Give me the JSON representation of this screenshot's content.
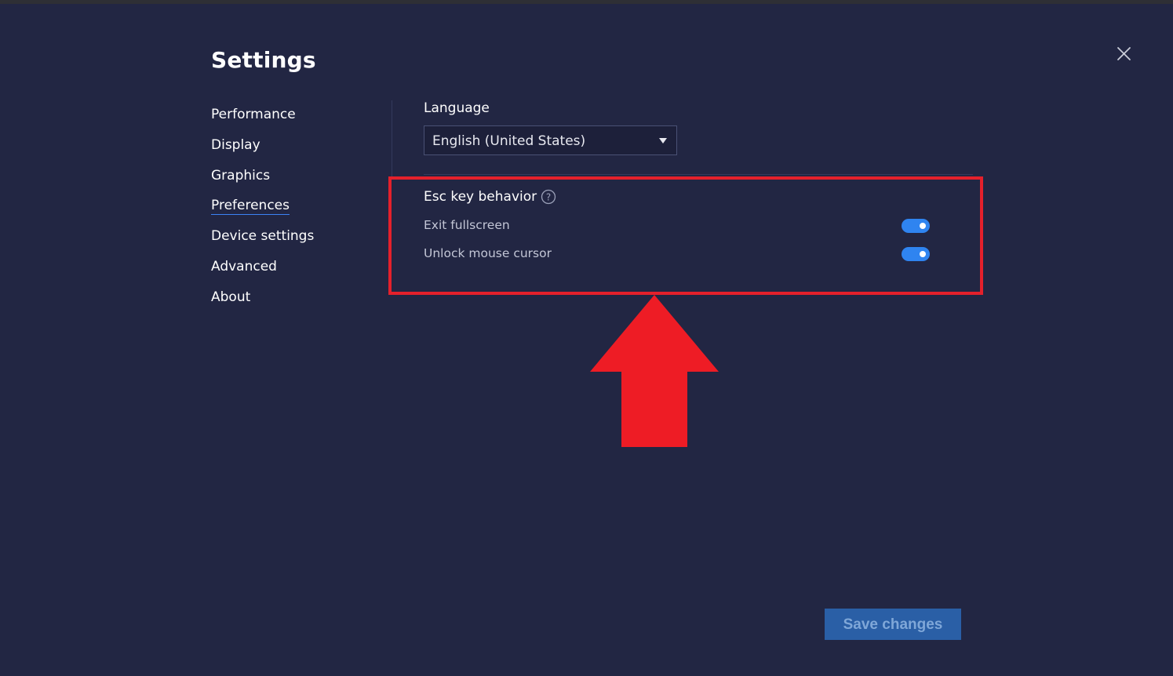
{
  "dialog": {
    "title": "Settings",
    "close_icon": "close-icon"
  },
  "nav": {
    "items": [
      {
        "label": "Performance",
        "active": false
      },
      {
        "label": "Display",
        "active": false
      },
      {
        "label": "Graphics",
        "active": false
      },
      {
        "label": "Preferences",
        "active": true
      },
      {
        "label": "Device settings",
        "active": false
      },
      {
        "label": "Advanced",
        "active": false
      },
      {
        "label": "About",
        "active": false
      }
    ]
  },
  "language": {
    "label": "Language",
    "selected": "English (United States)"
  },
  "esc_behavior": {
    "label": "Esc key behavior",
    "help_icon": "question-circle-icon",
    "options": [
      {
        "label": "Exit fullscreen",
        "enabled": true
      },
      {
        "label": "Unlock mouse cursor",
        "enabled": true
      }
    ]
  },
  "annotation": {
    "highlight_color": "#e4202b",
    "arrow_icon": "up-arrow-icon"
  },
  "footer": {
    "save_label": "Save changes"
  },
  "colors": {
    "background": "#222643",
    "accent": "#2f84f0",
    "save_button": "#2a5fa6"
  }
}
